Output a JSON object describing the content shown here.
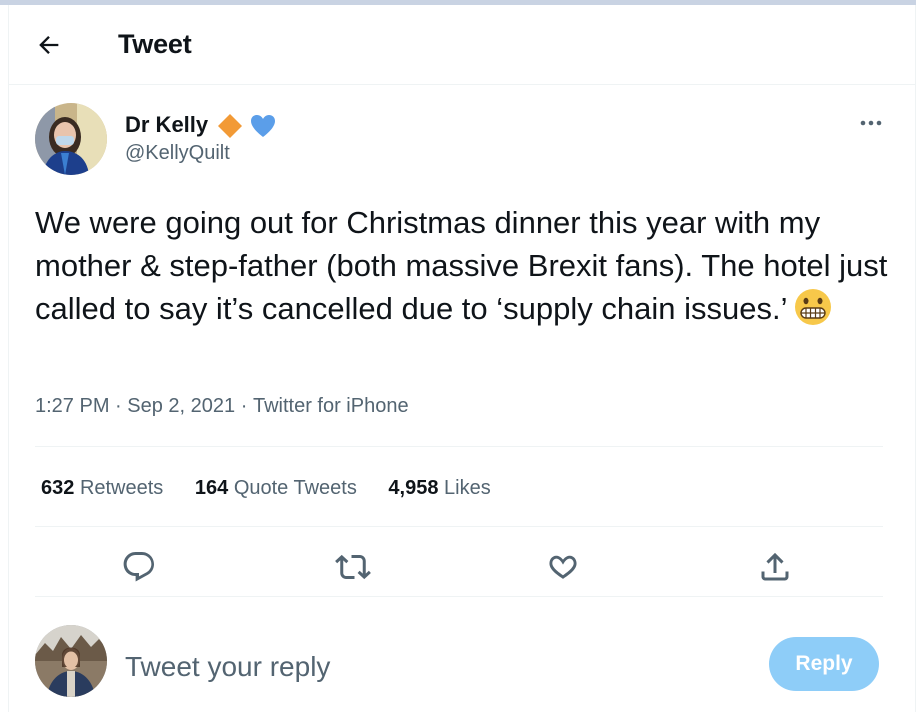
{
  "header": {
    "title": "Tweet",
    "back_icon": "arrow-left-icon"
  },
  "tweet": {
    "author": {
      "display_name": "Dr Kelly",
      "handle": "@KellyQuilt",
      "badges": [
        "orange-diamond-icon",
        "blue-heart-icon"
      ]
    },
    "text": "We were going out for Christmas dinner this year with my mother & step-father (both massive Brexit fans). The hotel just called to say it’s cancelled due to ‘supply chain issues.’",
    "emoji": "grimacing-face-icon",
    "time": "1:27 PM",
    "date": "Sep 2, 2021",
    "separator": "·",
    "source": "Twitter for iPhone"
  },
  "stats": {
    "retweets": {
      "value": "632",
      "label": "Retweets"
    },
    "quotes": {
      "value": "164",
      "label": "Quote Tweets"
    },
    "likes": {
      "value": "4,958",
      "label": "Likes"
    }
  },
  "actions": [
    "reply-icon",
    "retweet-icon",
    "like-icon",
    "share-icon"
  ],
  "reply_box": {
    "placeholder": "Tweet your reply",
    "button_label": "Reply"
  },
  "colors": {
    "text": "#0f1419",
    "secondary": "#536471",
    "border": "#eff3f4",
    "reply_button": "#8ecdf8",
    "diamond": "#f29a36",
    "heart": "#5b9ee9"
  }
}
